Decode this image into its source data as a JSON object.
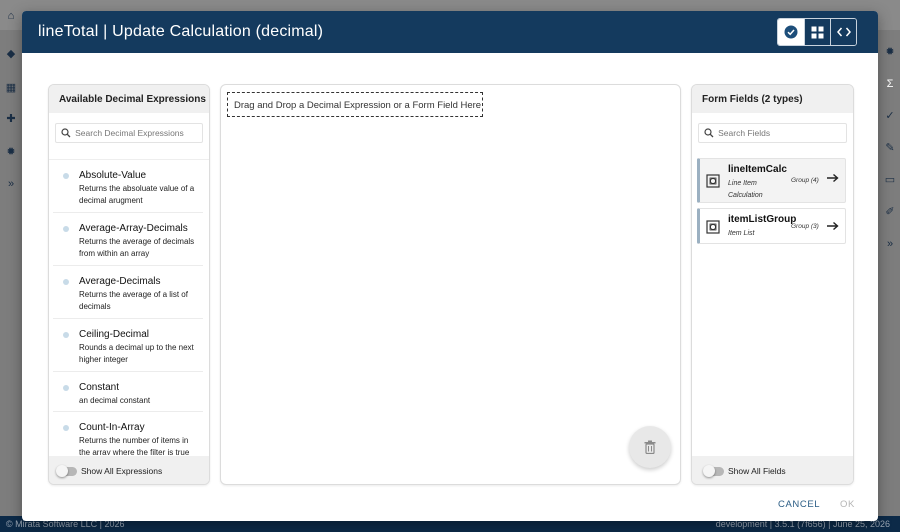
{
  "dialog": {
    "title": "lineTotal | Update Calculation (decimal)",
    "header_buttons": [
      {
        "icon": "check-circle-icon",
        "active": true
      },
      {
        "icon": "widgets-icon",
        "active": false
      },
      {
        "icon": "code-icon",
        "active": false
      }
    ]
  },
  "left_panel": {
    "title": "Available Decimal Expressions",
    "search_placeholder": "Search Decimal Expressions",
    "items": [
      {
        "name": "Absolute-Value",
        "description": "Returns the absoluate value of a decimal arugment"
      },
      {
        "name": "Average-Array-Decimals",
        "description": "Returns the average of decimals from within an array"
      },
      {
        "name": "Average-Decimals",
        "description": "Returns the average of a list of decimals"
      },
      {
        "name": "Ceiling-Decimal",
        "description": "Rounds a decimal up to the next higher integer"
      },
      {
        "name": "Constant",
        "description": "an decimal constant"
      },
      {
        "name": "Count-In-Array",
        "description": "Returns the number of items in the array where the filter is true"
      }
    ],
    "toggle_label": "Show All Expressions"
  },
  "center_panel": {
    "dropzone_text": "Drag and Drop a Decimal Expression or a Form Field Here",
    "trash_icon": "trash-icon"
  },
  "right_panel": {
    "title": "Form Fields (2 types)",
    "search_placeholder": "Search Fields",
    "fields": [
      {
        "name": "lineItemCalc",
        "description": "Line Item Calculation",
        "group": "Group (4)",
        "selected": true
      },
      {
        "name": "itemListGroup",
        "description": "Item List",
        "group": "Group (3)",
        "selected": false
      }
    ],
    "toggle_label": "Show All Fields"
  },
  "footer": {
    "cancel_label": "CANCEL",
    "ok_label": "OK"
  },
  "background": {
    "bottom_left": "© Mirata Software LLC | 2026",
    "bottom_right": "development | 3.5.1 (7f656) | June 25, 2026"
  },
  "colors": {
    "header": "#143a5e",
    "accent": "#2b5d85",
    "panel_head": "#f0f0f0"
  }
}
